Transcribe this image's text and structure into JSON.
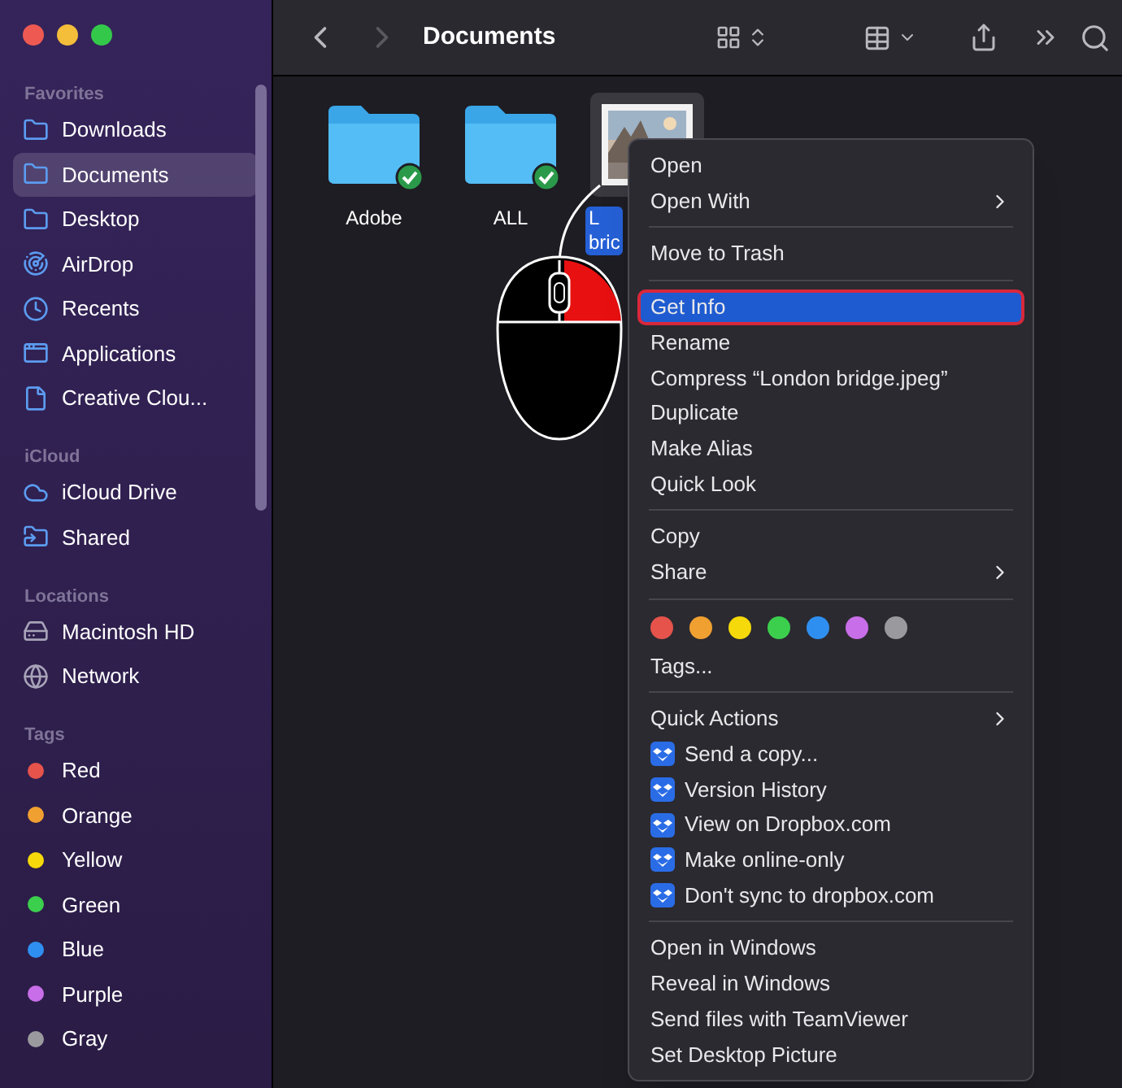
{
  "window": {
    "title": "Documents"
  },
  "sidebar": {
    "sections": [
      {
        "title": "Favorites",
        "items": [
          {
            "kind": "folder",
            "label": "Downloads",
            "selected": false
          },
          {
            "kind": "folder",
            "label": "Documents",
            "selected": true
          },
          {
            "kind": "folder",
            "label": "Desktop",
            "selected": false
          },
          {
            "kind": "airdrop",
            "label": "AirDrop",
            "selected": false
          },
          {
            "kind": "clock",
            "label": "Recents",
            "selected": false
          },
          {
            "kind": "apps",
            "label": "Applications",
            "selected": false
          },
          {
            "kind": "document",
            "label": "Creative Clou...",
            "selected": false
          }
        ]
      },
      {
        "title": "iCloud",
        "items": [
          {
            "kind": "cloud",
            "label": "iCloud Drive",
            "selected": false
          },
          {
            "kind": "shared",
            "label": "Shared",
            "selected": false
          }
        ]
      },
      {
        "title": "Locations",
        "items": [
          {
            "kind": "disk",
            "label": "Macintosh HD",
            "selected": false
          },
          {
            "kind": "globe",
            "label": "Network",
            "selected": false
          }
        ]
      },
      {
        "title": "Tags",
        "items": [
          {
            "kind": "tag",
            "label": "Red",
            "color": "#e5534b",
            "selected": false
          },
          {
            "kind": "tag",
            "label": "Orange",
            "color": "#f0a030",
            "selected": false
          },
          {
            "kind": "tag",
            "label": "Yellow",
            "color": "#f5d90a",
            "selected": false
          },
          {
            "kind": "tag",
            "label": "Green",
            "color": "#3ccf4e",
            "selected": false
          },
          {
            "kind": "tag",
            "label": "Blue",
            "color": "#2f8ff0",
            "selected": false
          },
          {
            "kind": "tag",
            "label": "Purple",
            "color": "#c86ee8",
            "selected": false
          },
          {
            "kind": "tag",
            "label": "Gray",
            "color": "#9a9a9e",
            "selected": false
          }
        ]
      }
    ]
  },
  "files": [
    {
      "kind": "folder",
      "label": [
        "Adobe"
      ],
      "synced": true,
      "selected": false
    },
    {
      "kind": "folder",
      "label": [
        "ALL"
      ],
      "synced": true,
      "selected": false
    },
    {
      "label": [
        "L",
        "bric"
      ],
      "synced": false,
      "selected": true
    }
  ],
  "menu": {
    "groups": [
      [
        {
          "kind": "action",
          "label": "Open",
          "selected": false
        },
        {
          "kind": "submenu",
          "label": "Open With",
          "selected": false
        }
      ],
      [
        {
          "kind": "action",
          "label": "Move to Trash",
          "selected": false
        }
      ],
      [
        {
          "kind": "action",
          "label": "Get Info",
          "selected": true
        },
        {
          "kind": "action",
          "label": "Rename",
          "selected": false
        },
        {
          "kind": "action",
          "label": "Compress “London bridge.jpeg”",
          "selected": false
        },
        {
          "kind": "action",
          "label": "Duplicate",
          "selected": false
        },
        {
          "kind": "action",
          "label": "Make Alias",
          "selected": false
        },
        {
          "kind": "action",
          "label": "Quick Look",
          "selected": false
        }
      ],
      [
        {
          "kind": "action",
          "label": "Copy",
          "selected": false
        },
        {
          "kind": "submenu",
          "label": "Share",
          "selected": false
        }
      ],
      [
        {
          "kind": "swatches",
          "colors": [
            {
              "color": "#e5534b"
            },
            {
              "color": "#f0a030"
            },
            {
              "color": "#f5d90a"
            },
            {
              "color": "#3ccf4e"
            },
            {
              "color": "#2f8ff0"
            },
            {
              "color": "#c86ee8"
            },
            {
              "color": "#9a9a9e"
            }
          ]
        },
        {
          "kind": "action",
          "label": "Tags...",
          "selected": false
        }
      ],
      [
        {
          "kind": "submenu",
          "label": "Quick Actions",
          "selected": false
        },
        {
          "kind": "dropbox",
          "label": "Send a copy...",
          "selected": false
        },
        {
          "kind": "dropbox",
          "label": "Version History",
          "selected": false
        },
        {
          "kind": "dropbox",
          "label": "View on Dropbox.com",
          "selected": false
        },
        {
          "kind": "dropbox",
          "label": "Make online-only",
          "selected": false
        },
        {
          "kind": "dropbox",
          "label": "Don't sync to dropbox.com",
          "selected": false
        }
      ],
      [
        {
          "kind": "action",
          "label": "Open in Windows",
          "selected": false
        },
        {
          "kind": "action",
          "label": "Reveal in Windows",
          "selected": false
        },
        {
          "kind": "action",
          "label": "Send files with TeamViewer",
          "selected": false
        },
        {
          "kind": "action",
          "label": "Set Desktop Picture",
          "selected": false
        }
      ]
    ]
  }
}
